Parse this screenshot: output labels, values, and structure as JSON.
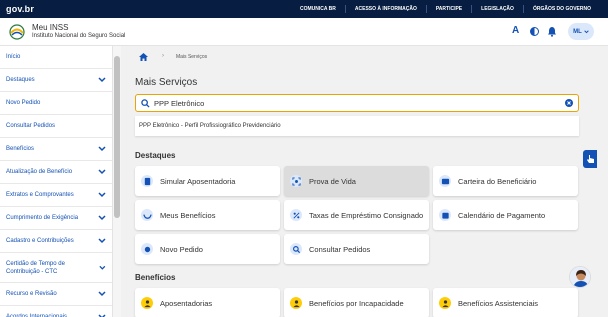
{
  "gov": {
    "logo": "gov.br",
    "links": [
      "COMUNICA BR",
      "ACESSO À INFORMAÇÃO",
      "PARTICIPE",
      "LEGISLAÇÃO",
      "ÓRGÃOS DO GOVERNO"
    ]
  },
  "header": {
    "app_title": "Meu INSS",
    "app_subtitle": "Instituto Nacional do Seguro Social",
    "font_size_label": "A",
    "user_initials": "ML"
  },
  "sidebar": {
    "items": [
      {
        "label": "Início",
        "expandable": false
      },
      {
        "label": "Destaques",
        "expandable": true
      },
      {
        "label": "Novo Pedido",
        "expandable": false
      },
      {
        "label": "Consultar Pedidos",
        "expandable": false
      },
      {
        "label": "Benefícios",
        "expandable": true
      },
      {
        "label": "Atualização de Benefício",
        "expandable": true
      },
      {
        "label": "Extratos e Comprovantes",
        "expandable": true
      },
      {
        "label": "Cumprimento de Exigência",
        "expandable": true
      },
      {
        "label": "Cadastro e Contribuições",
        "expandable": true
      },
      {
        "label": "Certidão de Tempo de Contribuição - CTC",
        "expandable": true
      },
      {
        "label": "Recurso e Revisão",
        "expandable": true
      },
      {
        "label": "Acordos Internacionais",
        "expandable": true
      }
    ]
  },
  "main": {
    "breadcrumb": "Mais Serviços",
    "title": "Mais Serviços",
    "search": {
      "value": "PPP Eletrônico"
    },
    "suggestion": "PPP Eletrônico - Perfil Profissiográfico Previdenciário",
    "destaques": {
      "heading": "Destaques",
      "cards": [
        {
          "label": "Simular Aposentadoria",
          "icon": "calculator-icon"
        },
        {
          "label": "Prova de Vida",
          "icon": "face-scan-icon"
        },
        {
          "label": "Carteira do Beneficiário",
          "icon": "id-card-icon"
        },
        {
          "label": "Meus Benefícios",
          "icon": "hands-icon"
        },
        {
          "label": "Taxas de Empréstimo Consignado",
          "icon": "percent-icon"
        },
        {
          "label": "Calendário de Pagamento",
          "icon": "calendar-icon"
        },
        {
          "label": "Novo Pedido",
          "icon": "plus-icon"
        },
        {
          "label": "Consultar Pedidos",
          "icon": "search-icon"
        }
      ]
    },
    "beneficios": {
      "heading": "Benefícios",
      "cards": [
        {
          "label": "Aposentadorias",
          "icon": "person-icon"
        },
        {
          "label": "Benefícios por Incapacidade",
          "icon": "person-icon"
        },
        {
          "label": "Benefícios Assistenciais",
          "icon": "person-icon"
        }
      ]
    }
  },
  "colors": {
    "primary": "#1351b4",
    "gov_bar": "#071d41",
    "search_border": "#e8a400",
    "accent_yellow": "#ffcd07"
  }
}
